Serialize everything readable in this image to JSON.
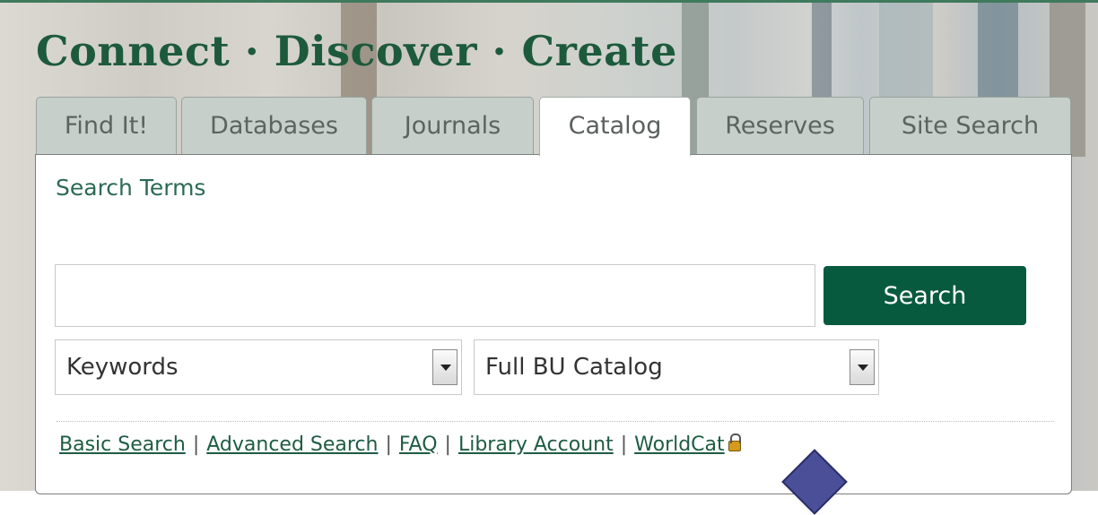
{
  "header": {
    "tagline": "Connect · Discover · Create"
  },
  "tabs": [
    {
      "label": "Find It!",
      "active": false
    },
    {
      "label": "Databases",
      "active": false
    },
    {
      "label": "Journals",
      "active": false
    },
    {
      "label": "Catalog",
      "active": true
    },
    {
      "label": "Reserves",
      "active": false
    },
    {
      "label": "Site Search",
      "active": false
    }
  ],
  "search": {
    "label": "Search Terms",
    "input_value": "",
    "button_label": "Search"
  },
  "selects": {
    "field": {
      "value": "Keywords"
    },
    "scope": {
      "value": "Full BU Catalog"
    }
  },
  "links": {
    "basic_search": "Basic Search",
    "advanced_search": "Advanced Search",
    "faq": "FAQ",
    "library_account": "Library Account",
    "worldcat": "WorldCat",
    "separator": "|"
  },
  "icons": {
    "worldcat_lock": "lock-icon",
    "select_arrow": "chevron-down-icon"
  },
  "colors": {
    "brand_green": "#085a3f",
    "tagline_green": "#1d5a3c",
    "link_green": "#1e5c44",
    "pointer_marker": "#4a4f97"
  }
}
